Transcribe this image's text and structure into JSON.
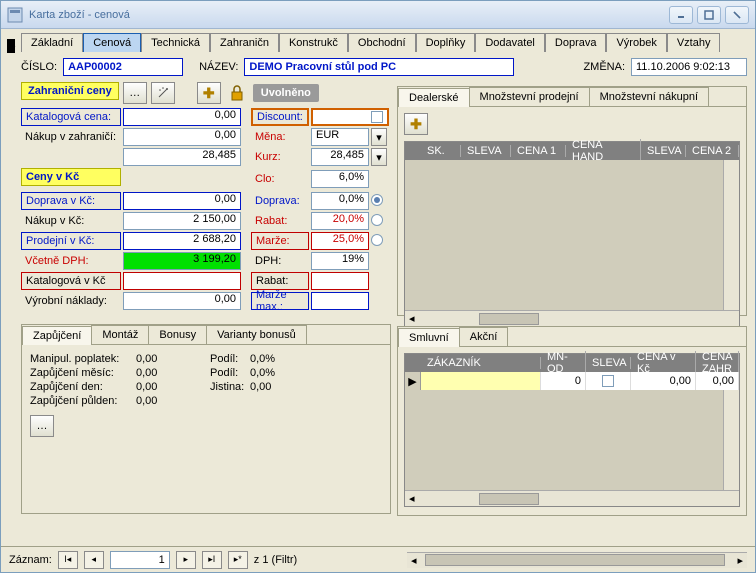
{
  "window": {
    "title": "Karta zboží - cenová"
  },
  "mainTabs": [
    "Základní",
    "Cenová",
    "Technická",
    "Zahraničn",
    "Konstrukč",
    "Obchodní",
    "Doplňky",
    "Dodavatel",
    "Doprava",
    "Výrobek",
    "Vztahy"
  ],
  "mainTabActive": 1,
  "header": {
    "cisloLbl": "ČÍSLO:",
    "cislo": "AAP00002",
    "nazevLbl": "NÁZEV:",
    "nazev": "DEMO Pracovní stůl pod PC",
    "zmenaLbl": "ZMĚNA:",
    "zmena": "11.10.2006 9:02:13"
  },
  "sections": {
    "foreign": "Zahraniční ceny",
    "czk": "Ceny v Kč",
    "released": "Uvolněno"
  },
  "form": {
    "r1": {
      "l": "Katalogová cena:",
      "v": "0,00",
      "l2": "Discount:",
      "v2": ""
    },
    "r2": {
      "l": "Nákup v zahraničí:",
      "v": "0,00",
      "l2": "Měna:",
      "v2": "EUR"
    },
    "r3": {
      "l": "",
      "v": "28,485",
      "l2": "Kurz:",
      "v2": "28,485"
    },
    "r4": {
      "l": "",
      "v": "",
      "l2": "Clo:",
      "v2": "6,0%"
    },
    "r5": {
      "l": "Doprava v Kč:",
      "v": "0,00",
      "l2": "Doprava:",
      "v2": "0,0%"
    },
    "r6": {
      "l": "Nákup v Kč:",
      "v": "2 150,00",
      "l2": "Rabat:",
      "v2": "20,0%"
    },
    "r7": {
      "l": "Prodejní v Kč:",
      "v": "2 688,20",
      "l2": "Marže:",
      "v2": "25,0%"
    },
    "r8": {
      "l": "Včetně DPH:",
      "v": "3 199,20",
      "l2": "DPH:",
      "v2": "19%"
    },
    "r9": {
      "l": "Katalogová v Kč",
      "v": "",
      "l2": "Rabat:",
      "v2": ""
    },
    "r10": {
      "l": "Výrobní náklady:",
      "v": "0,00",
      "l2": "Marže max.:",
      "v2": ""
    }
  },
  "dealerTabs": [
    "Dealerské",
    "Množstevní prodejní",
    "Množstevní nákupní"
  ],
  "dealerCols": [
    "SK.",
    "SLEVA",
    "CENA 1",
    "CENA HAND",
    "SLEVA",
    "CENA 2"
  ],
  "loanTabs": [
    "Zapůjčení",
    "Montáž",
    "Bonusy",
    "Varianty bonusů"
  ],
  "loan": {
    "r1": {
      "l": "Manipul. poplatek:",
      "v": "0,00",
      "l2": "Podíl:",
      "v2": "0,0%"
    },
    "r2": {
      "l": "Zapůjčení měsíc:",
      "v": "0,00",
      "l2": "Podíl:",
      "v2": "0,0%"
    },
    "r3": {
      "l": "Zapůjčení den:",
      "v": "0,00",
      "l2": "Jistina:",
      "v2": "0,00"
    },
    "r4": {
      "l": "Zapůjčení půlden:",
      "v": "0,00"
    }
  },
  "contractTabs": [
    "Smluvní",
    "Akční"
  ],
  "contractCols": [
    "ZÁKAZNÍK",
    "MN-OD",
    "SLEVA",
    "CENA v Kč",
    "CENA ZAHR"
  ],
  "contractRow": {
    "zakaznik": "",
    "mnod": "0",
    "sleva": "",
    "cena": "0,00",
    "cenazahr": "0,00"
  },
  "footer": {
    "zaznam": "Záznam:",
    "pos": "1",
    "total": "z  1 (Filtr)"
  }
}
